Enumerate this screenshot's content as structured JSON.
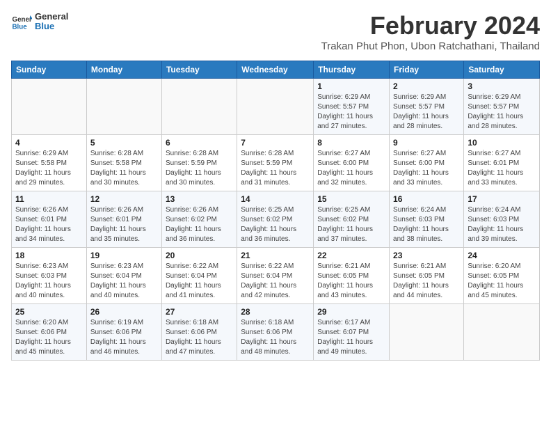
{
  "header": {
    "logo_general": "General",
    "logo_blue": "Blue",
    "month_title": "February 2024",
    "location": "Trakan Phut Phon, Ubon Ratchathani, Thailand"
  },
  "weekdays": [
    "Sunday",
    "Monday",
    "Tuesday",
    "Wednesday",
    "Thursday",
    "Friday",
    "Saturday"
  ],
  "weeks": [
    [
      {
        "day": "",
        "info": ""
      },
      {
        "day": "",
        "info": ""
      },
      {
        "day": "",
        "info": ""
      },
      {
        "day": "",
        "info": ""
      },
      {
        "day": "1",
        "info": "Sunrise: 6:29 AM\nSunset: 5:57 PM\nDaylight: 11 hours\nand 27 minutes."
      },
      {
        "day": "2",
        "info": "Sunrise: 6:29 AM\nSunset: 5:57 PM\nDaylight: 11 hours\nand 28 minutes."
      },
      {
        "day": "3",
        "info": "Sunrise: 6:29 AM\nSunset: 5:57 PM\nDaylight: 11 hours\nand 28 minutes."
      }
    ],
    [
      {
        "day": "4",
        "info": "Sunrise: 6:29 AM\nSunset: 5:58 PM\nDaylight: 11 hours\nand 29 minutes."
      },
      {
        "day": "5",
        "info": "Sunrise: 6:28 AM\nSunset: 5:58 PM\nDaylight: 11 hours\nand 30 minutes."
      },
      {
        "day": "6",
        "info": "Sunrise: 6:28 AM\nSunset: 5:59 PM\nDaylight: 11 hours\nand 30 minutes."
      },
      {
        "day": "7",
        "info": "Sunrise: 6:28 AM\nSunset: 5:59 PM\nDaylight: 11 hours\nand 31 minutes."
      },
      {
        "day": "8",
        "info": "Sunrise: 6:27 AM\nSunset: 6:00 PM\nDaylight: 11 hours\nand 32 minutes."
      },
      {
        "day": "9",
        "info": "Sunrise: 6:27 AM\nSunset: 6:00 PM\nDaylight: 11 hours\nand 33 minutes."
      },
      {
        "day": "10",
        "info": "Sunrise: 6:27 AM\nSunset: 6:01 PM\nDaylight: 11 hours\nand 33 minutes."
      }
    ],
    [
      {
        "day": "11",
        "info": "Sunrise: 6:26 AM\nSunset: 6:01 PM\nDaylight: 11 hours\nand 34 minutes."
      },
      {
        "day": "12",
        "info": "Sunrise: 6:26 AM\nSunset: 6:01 PM\nDaylight: 11 hours\nand 35 minutes."
      },
      {
        "day": "13",
        "info": "Sunrise: 6:26 AM\nSunset: 6:02 PM\nDaylight: 11 hours\nand 36 minutes."
      },
      {
        "day": "14",
        "info": "Sunrise: 6:25 AM\nSunset: 6:02 PM\nDaylight: 11 hours\nand 36 minutes."
      },
      {
        "day": "15",
        "info": "Sunrise: 6:25 AM\nSunset: 6:02 PM\nDaylight: 11 hours\nand 37 minutes."
      },
      {
        "day": "16",
        "info": "Sunrise: 6:24 AM\nSunset: 6:03 PM\nDaylight: 11 hours\nand 38 minutes."
      },
      {
        "day": "17",
        "info": "Sunrise: 6:24 AM\nSunset: 6:03 PM\nDaylight: 11 hours\nand 39 minutes."
      }
    ],
    [
      {
        "day": "18",
        "info": "Sunrise: 6:23 AM\nSunset: 6:03 PM\nDaylight: 11 hours\nand 40 minutes."
      },
      {
        "day": "19",
        "info": "Sunrise: 6:23 AM\nSunset: 6:04 PM\nDaylight: 11 hours\nand 40 minutes."
      },
      {
        "day": "20",
        "info": "Sunrise: 6:22 AM\nSunset: 6:04 PM\nDaylight: 11 hours\nand 41 minutes."
      },
      {
        "day": "21",
        "info": "Sunrise: 6:22 AM\nSunset: 6:04 PM\nDaylight: 11 hours\nand 42 minutes."
      },
      {
        "day": "22",
        "info": "Sunrise: 6:21 AM\nSunset: 6:05 PM\nDaylight: 11 hours\nand 43 minutes."
      },
      {
        "day": "23",
        "info": "Sunrise: 6:21 AM\nSunset: 6:05 PM\nDaylight: 11 hours\nand 44 minutes."
      },
      {
        "day": "24",
        "info": "Sunrise: 6:20 AM\nSunset: 6:05 PM\nDaylight: 11 hours\nand 45 minutes."
      }
    ],
    [
      {
        "day": "25",
        "info": "Sunrise: 6:20 AM\nSunset: 6:06 PM\nDaylight: 11 hours\nand 45 minutes."
      },
      {
        "day": "26",
        "info": "Sunrise: 6:19 AM\nSunset: 6:06 PM\nDaylight: 11 hours\nand 46 minutes."
      },
      {
        "day": "27",
        "info": "Sunrise: 6:18 AM\nSunset: 6:06 PM\nDaylight: 11 hours\nand 47 minutes."
      },
      {
        "day": "28",
        "info": "Sunrise: 6:18 AM\nSunset: 6:06 PM\nDaylight: 11 hours\nand 48 minutes."
      },
      {
        "day": "29",
        "info": "Sunrise: 6:17 AM\nSunset: 6:07 PM\nDaylight: 11 hours\nand 49 minutes."
      },
      {
        "day": "",
        "info": ""
      },
      {
        "day": "",
        "info": ""
      }
    ]
  ]
}
